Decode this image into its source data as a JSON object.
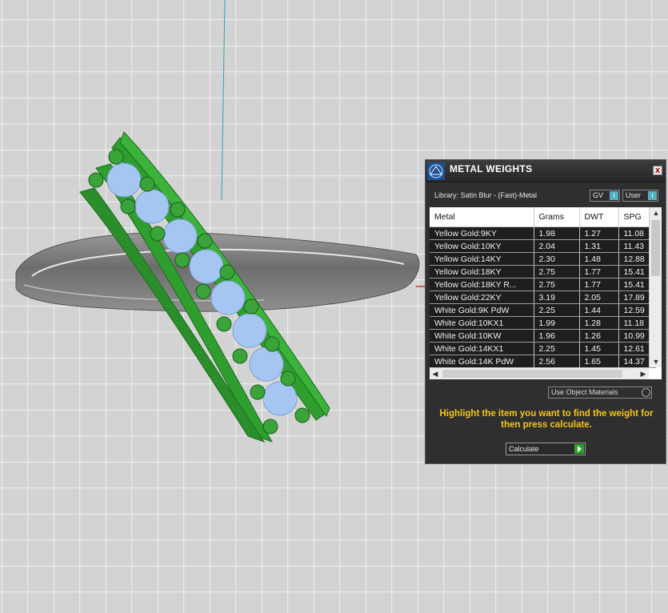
{
  "panel": {
    "title": "METAL WEIGHTS",
    "close_label": "x",
    "library": "Library: Satin Blur - (Fast)-Metal",
    "toggles": [
      {
        "label": "GV",
        "knob": "I"
      },
      {
        "label": "User",
        "knob": "I"
      }
    ],
    "table": {
      "columns": [
        "Metal",
        "Grams",
        "DWT",
        "SPG"
      ],
      "rows": [
        [
          "Yellow Gold:9KY",
          "1.98",
          "1.27",
          "11.08"
        ],
        [
          "Yellow Gold:10KY",
          "2.04",
          "1.31",
          "11.43"
        ],
        [
          "Yellow Gold:14KY",
          "2.30",
          "1.48",
          "12.88"
        ],
        [
          "Yellow Gold:18KY",
          "2.75",
          "1.77",
          "15.41"
        ],
        [
          "Yellow Gold:18KY R...",
          "2.75",
          "1.77",
          "15.41"
        ],
        [
          "Yellow Gold:22KY",
          "3.19",
          "2.05",
          "17.89"
        ],
        [
          "White Gold:9K PdW",
          "2.25",
          "1.44",
          "12.59"
        ],
        [
          "White Gold:10KX1",
          "1.99",
          "1.28",
          "11.18"
        ],
        [
          "White Gold:10KW",
          "1.96",
          "1.26",
          "10.99"
        ],
        [
          "White Gold:14KX1",
          "2.25",
          "1.45",
          "12.61"
        ],
        [
          "White Gold:14K PdW",
          "2.56",
          "1.65",
          "14.37"
        ]
      ]
    },
    "use_object_materials": "Use Object Materials",
    "instruction": "Highlight the item you want to find the weight for then press calculate.",
    "calculate_label": "Calculate"
  },
  "colors": {
    "panel_bg": "#2f2f2f",
    "instruction_text": "#f5c518",
    "ring_green": "#2e9e2e",
    "gem_blue": "#9ec4f2",
    "band_grey": "#7a7a7a"
  }
}
